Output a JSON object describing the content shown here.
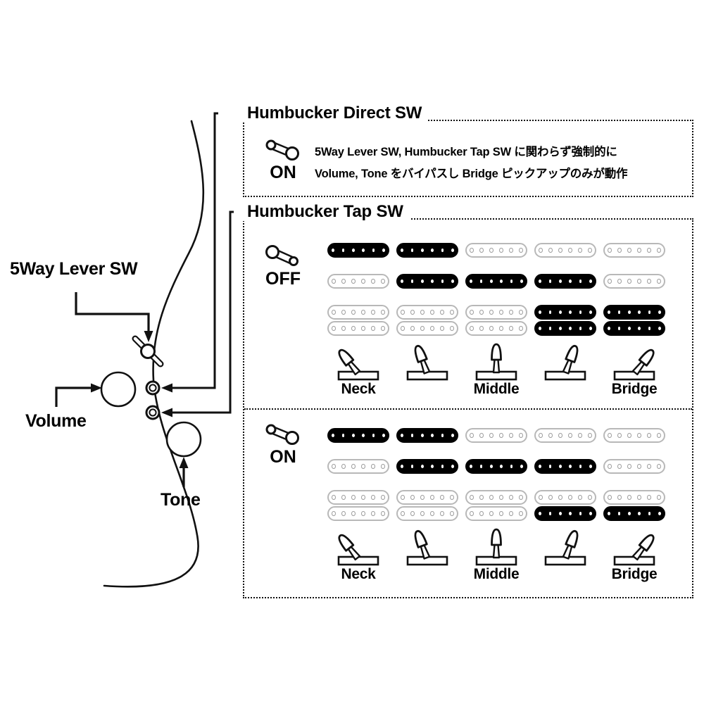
{
  "diagram": {
    "title_alt": "Guitar Wiring Control Layout Diagram"
  },
  "guitar": {
    "labels": {
      "lever_sw": "5Way Lever SW",
      "volume": "Volume",
      "tone": "Tone"
    },
    "controls": [
      {
        "name": "lever-switch",
        "label": "5Way Lever SW"
      },
      {
        "name": "volume-knob",
        "label": "Volume"
      },
      {
        "name": "tone-knob",
        "label": "Tone"
      },
      {
        "name": "humbucker-direct-mini-toggle",
        "label": ""
      },
      {
        "name": "humbucker-tap-mini-toggle",
        "label": ""
      }
    ]
  },
  "direct_sw": {
    "title": "Humbucker Direct SW",
    "state": "ON",
    "description_line1": "5Way Lever SW, Humbucker Tap SW に関わらず強制的に",
    "description_line2": "Volume, Tone をバイパスし Bridge ピックアップのみが動作"
  },
  "tap_sw": {
    "title": "Humbucker Tap SW",
    "sections": [
      {
        "state": "OFF",
        "position_labels": [
          "Neck",
          "",
          "Middle",
          "",
          "Bridge"
        ],
        "rows": [
          {
            "pickup": "neck-single-coil",
            "type": "single",
            "active": [
              true,
              true,
              false,
              false,
              false
            ]
          },
          {
            "pickup": "middle-single-coil",
            "type": "single",
            "active": [
              false,
              true,
              true,
              true,
              false
            ]
          },
          {
            "pickup": "bridge-humbucker",
            "type": "humbucker",
            "active_top": [
              false,
              false,
              false,
              true,
              true
            ],
            "active_bottom": [
              false,
              false,
              false,
              true,
              true
            ]
          }
        ]
      },
      {
        "state": "ON",
        "position_labels": [
          "Neck",
          "",
          "Middle",
          "",
          "Bridge"
        ],
        "rows": [
          {
            "pickup": "neck-single-coil",
            "type": "single",
            "active": [
              true,
              true,
              false,
              false,
              false
            ]
          },
          {
            "pickup": "middle-single-coil",
            "type": "single",
            "active": [
              false,
              true,
              true,
              true,
              false
            ]
          },
          {
            "pickup": "bridge-humbucker",
            "type": "humbucker",
            "active_top": [
              false,
              false,
              false,
              false,
              false
            ],
            "active_bottom": [
              false,
              false,
              false,
              true,
              true
            ]
          }
        ]
      }
    ]
  },
  "colors": {
    "ink": "#000000",
    "inactive_outline": "#b8b8b8",
    "inactive_pole": "#9d9d9d",
    "background": "#ffffff"
  }
}
